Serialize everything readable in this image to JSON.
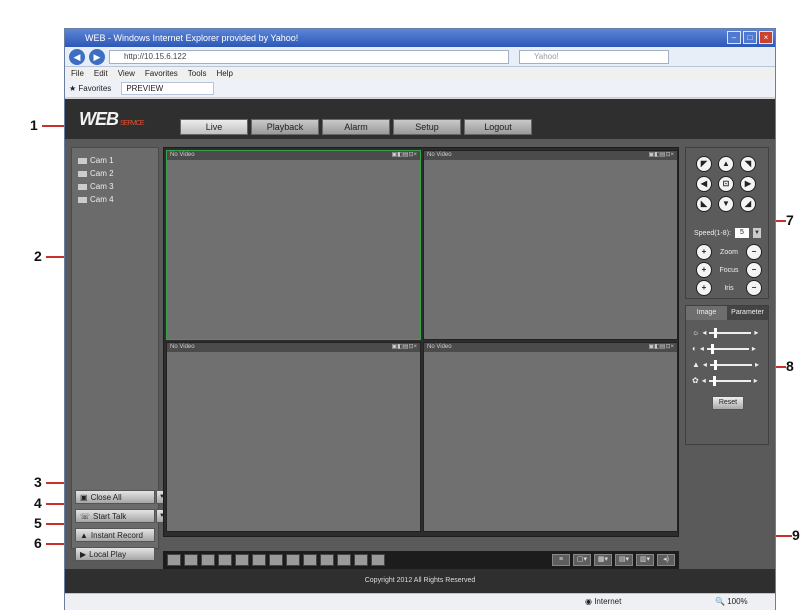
{
  "browser": {
    "title": "WEB - Windows Internet Explorer provided by Yahoo!",
    "url": "http://10.15.6.122",
    "search_placeholder": "Yahoo!",
    "menu": [
      "File",
      "Edit",
      "View",
      "Favorites",
      "Tools",
      "Help"
    ],
    "favorites_label": "Favorites",
    "favorite_tab": "PREVIEW",
    "status_zone": "Internet",
    "status_zoom": "100%"
  },
  "app": {
    "logo": "WEB",
    "logo_sub": "SERVICE",
    "tabs": [
      "Live",
      "Playback",
      "Alarm",
      "Setup",
      "Logout"
    ],
    "active_tab": "Live",
    "channels": [
      "Cam 1",
      "Cam 2",
      "Cam 3",
      "Cam 4"
    ],
    "buttons": {
      "close_all": "Close All",
      "start_talk": "Start Talk",
      "instant_record": "Instant Record",
      "local_play": "Local Play"
    },
    "video_cells": [
      {
        "label": "No Video",
        "status": "Selected"
      },
      {
        "label": "No Video",
        "status": ""
      },
      {
        "label": "No Video",
        "status": ""
      },
      {
        "label": "No Video",
        "status": ""
      }
    ],
    "ptz": {
      "speed_label": "Speed(1-8):",
      "speed_value": "5",
      "zoom_label": "Zoom",
      "focus_label": "Focus",
      "iris_label": "Iris"
    },
    "image_panel": {
      "tabs": [
        "Image",
        "Parameter"
      ],
      "active_tab": "Image",
      "settings": [
        {
          "icon": "brightness-icon",
          "level": 0.1
        },
        {
          "icon": "contrast-icon",
          "level": 0.1
        },
        {
          "icon": "saturation-icon",
          "level": 0.1
        },
        {
          "icon": "hue-icon",
          "level": 0.1
        }
      ],
      "reset_label": "Reset"
    },
    "footer": "Copyright 2012 All Rights Reserved"
  },
  "callouts": [
    "1",
    "2",
    "3",
    "4",
    "5",
    "6",
    "7",
    "8",
    "9"
  ]
}
